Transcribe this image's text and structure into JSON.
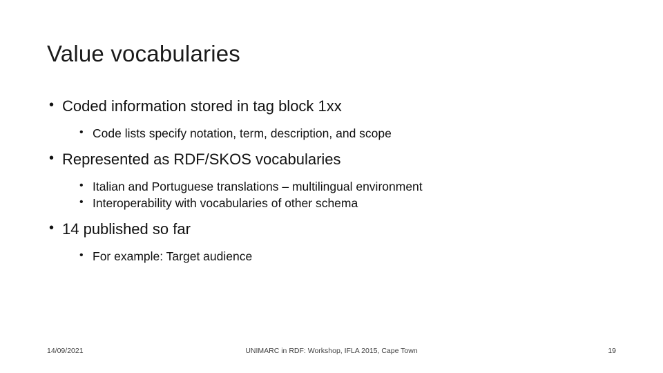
{
  "slide": {
    "title": "Value vocabularies",
    "bullets": [
      {
        "level": 1,
        "text": "Coded information stored in tag block 1xx"
      },
      {
        "level": 2,
        "text": "Code lists specify notation, term, description, and scope"
      },
      {
        "level": 1,
        "text": "Represented as RDF/SKOS vocabularies"
      },
      {
        "level": 2,
        "text": "Italian and Portuguese translations – multilingual environment"
      },
      {
        "level": 2,
        "text": "Interoperability with vocabularies of other schema"
      },
      {
        "level": 1,
        "text": "14 published so far"
      },
      {
        "level": 2,
        "text": "For example: Target audience"
      }
    ],
    "footer": {
      "date": "14/09/2021",
      "center": "UNIMARC in RDF: Workshop, IFLA 2015, Cape Town",
      "page": "19"
    }
  }
}
